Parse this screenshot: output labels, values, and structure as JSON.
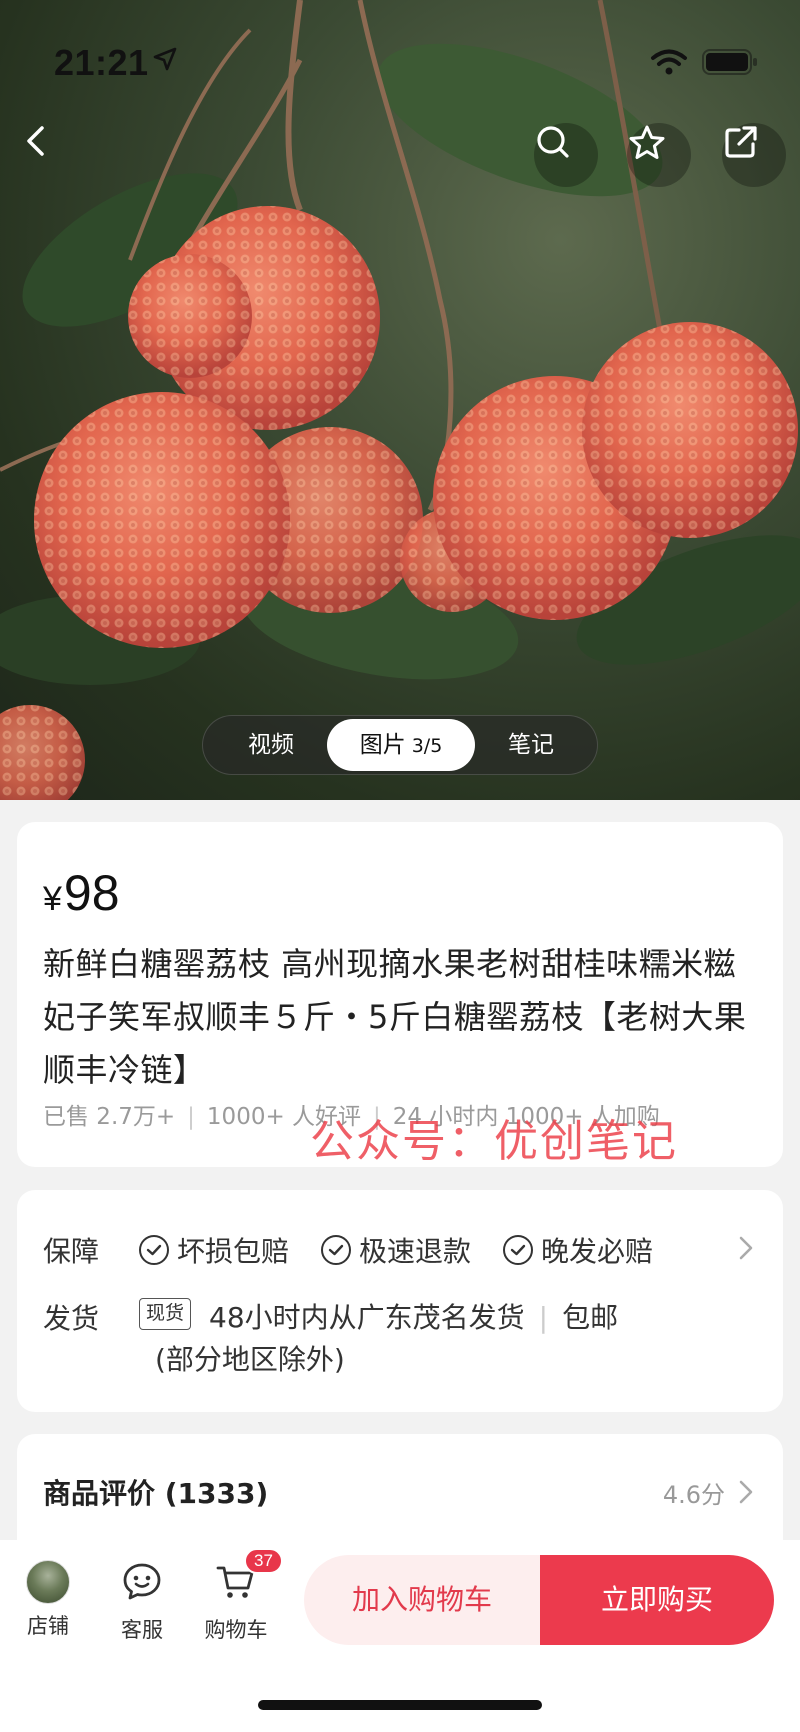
{
  "status": {
    "time": "21:21"
  },
  "media_tabs": {
    "video": "视频",
    "photo": "图片",
    "photo_count": "3/5",
    "notes": "笔记"
  },
  "product": {
    "currency": "¥",
    "price": "98",
    "title": "新鲜白糖罂荔枝 高州现摘水果老树甜桂味糯米糍妃子笑军叔顺丰５斤・5斤白糖罂荔枝【老树大果 顺丰冷链】",
    "sold": "已售 2.7万+",
    "good_reviews": "1000+ 人好评",
    "recent_adds": "24 小时内 1000+ 人加购"
  },
  "watermark": "公众号：优创笔记",
  "service": {
    "guarantee_label": "保障",
    "guarantees": [
      "坏损包赔",
      "极速退款",
      "晚发必赔"
    ],
    "shipping_label": "发货",
    "shipping_badge": "现货",
    "shipping_text": "48小时内从广东茂名发货",
    "shipping_free": "包邮",
    "shipping_note": "(部分地区除外)"
  },
  "review": {
    "title": "商品评价 (1333)",
    "score": "4.6分"
  },
  "bottom_bar": {
    "store": "店铺",
    "customer_service": "客服",
    "cart": "购物车",
    "cart_count": "37",
    "add_to_cart": "加入购物车",
    "buy_now": "立即购买"
  },
  "colors": {
    "accent": "#ec3a4d",
    "accent_light": "#fdeeee",
    "fruit": "#e2664e"
  }
}
